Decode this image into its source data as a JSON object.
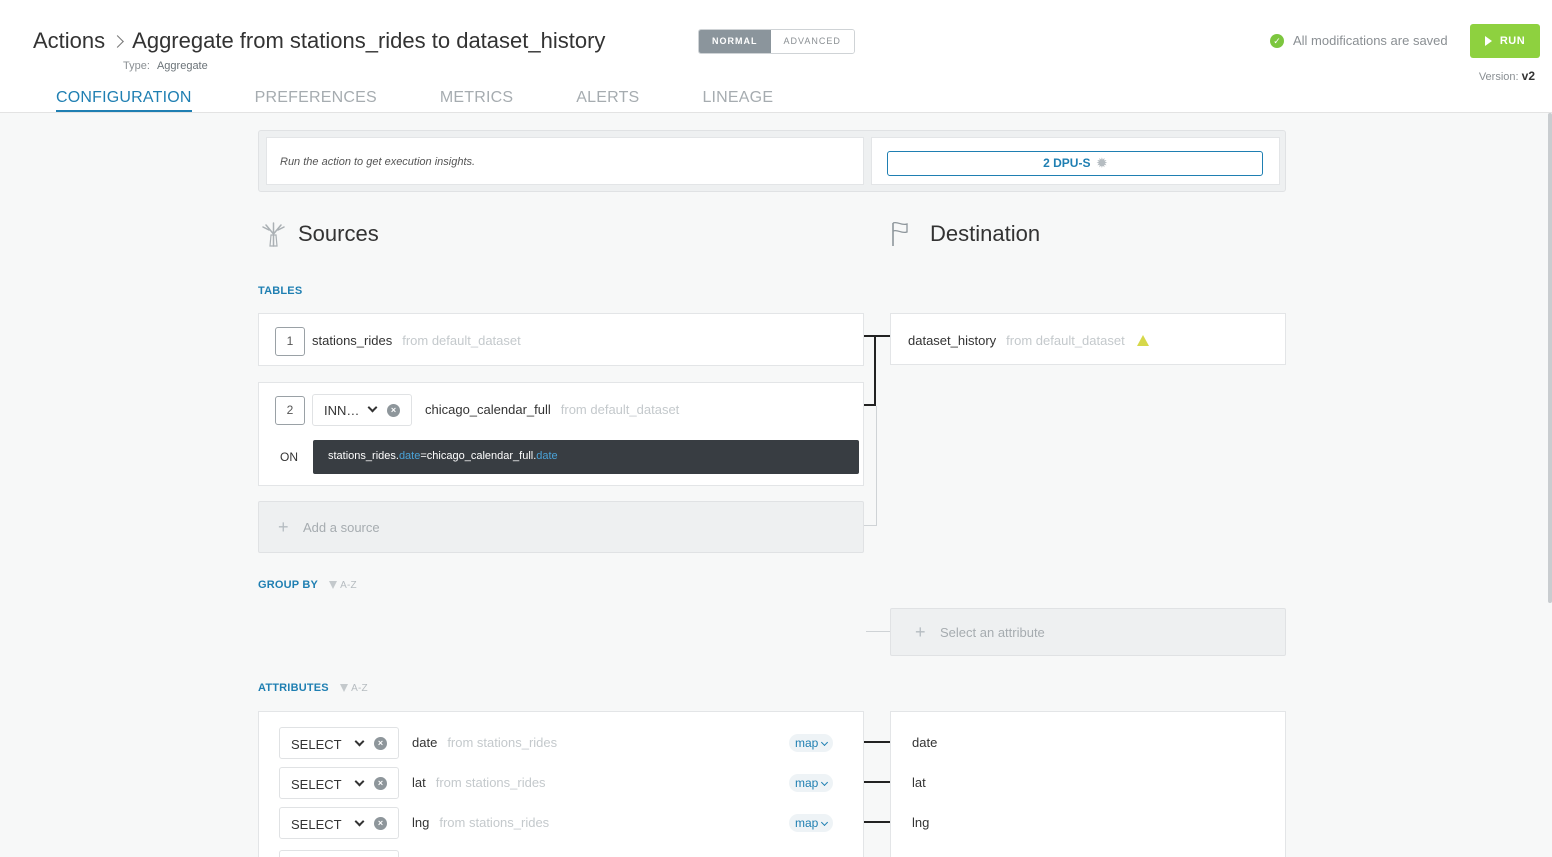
{
  "header": {
    "breadcrumb_parent": "Actions",
    "title": "Aggregate from stations_rides to dataset_history",
    "type_label": "Type:",
    "type_value": "Aggregate",
    "mode_normal": "NORMAL",
    "mode_advanced": "ADVANCED",
    "saved_status": "All modifications are saved",
    "run_label": "RUN",
    "version_label": "Version:",
    "version_value": "v2"
  },
  "tabs": [
    "CONFIGURATION",
    "PREFERENCES",
    "METRICS",
    "ALERTS",
    "LINEAGE"
  ],
  "insights": {
    "message": "Run the action to get execution insights.",
    "dpu_label": "2 DPU-S"
  },
  "sources": {
    "heading": "Sources",
    "tables_label": "TABLES",
    "tables": [
      {
        "index": "1",
        "name": "stations_rides",
        "from": "from default_dataset"
      },
      {
        "index": "2",
        "join": "INN…",
        "name": "chicago_calendar_full",
        "from": "from default_dataset"
      }
    ],
    "on_label": "ON",
    "condition": {
      "left_table": "stations_rides.",
      "left_col": "date",
      "op": "=",
      "right_table": "chicago_calendar_full.",
      "right_col": "date"
    },
    "add_source": "Add a source"
  },
  "destination": {
    "heading": "Destination",
    "table": {
      "name": "dataset_history",
      "from": "from default_dataset"
    }
  },
  "group_by": {
    "label": "GROUP BY",
    "sort": "A-Z",
    "select_attribute": "Select an attribute"
  },
  "attributes": {
    "label": "ATTRIBUTES",
    "sort": "A-Z",
    "rows": [
      {
        "op": "SELECT",
        "name": "date",
        "from": "from stations_rides",
        "map": "map",
        "dest": "date"
      },
      {
        "op": "SELECT",
        "name": "lat",
        "from": "from stations_rides",
        "map": "map",
        "dest": "lat"
      },
      {
        "op": "SELECT",
        "name": "lng",
        "from": "from stations_rides",
        "map": "map",
        "dest": "lng"
      }
    ]
  },
  "colors": {
    "accent": "#1f7fb2",
    "run_button": "#8ed13f",
    "saved_check": "#7cc63e",
    "condition_bg": "#383d42"
  }
}
